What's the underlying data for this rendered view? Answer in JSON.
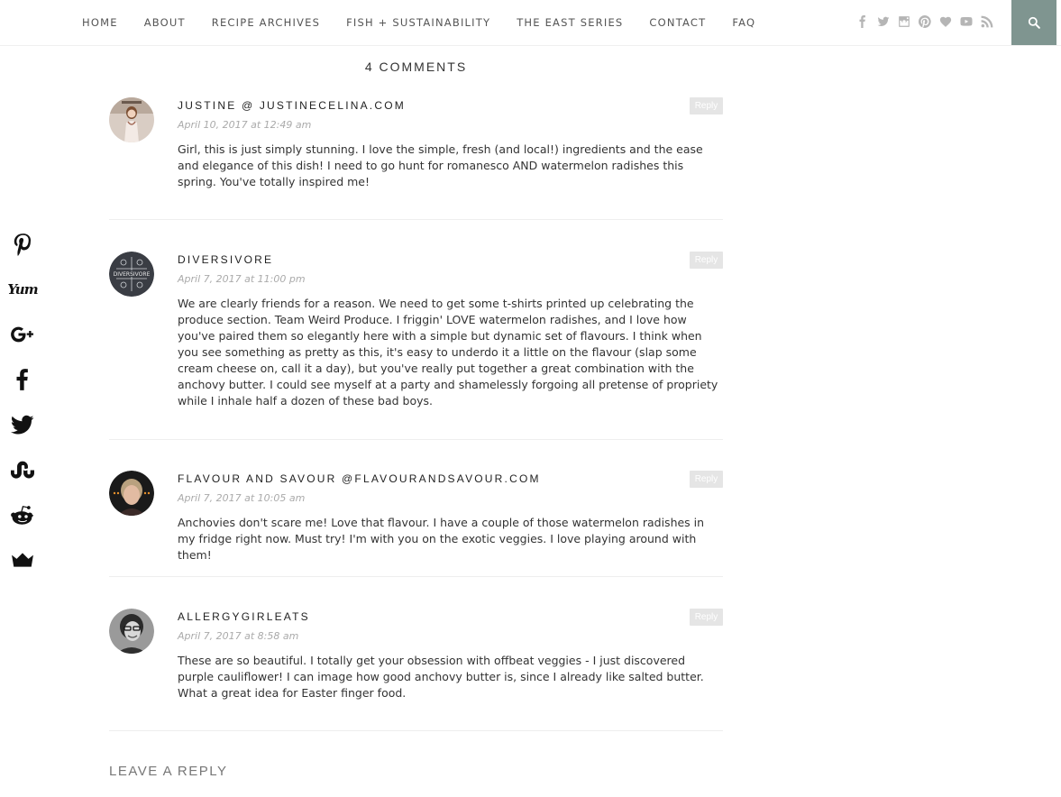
{
  "nav": {
    "items": [
      "HOME",
      "ABOUT",
      "RECIPE ARCHIVES",
      "FISH + SUSTAINABILITY",
      "THE EAST SERIES",
      "CONTACT",
      "FAQ"
    ]
  },
  "social_top": [
    "facebook-icon",
    "twitter-icon",
    "instagram-icon",
    "pinterest-icon",
    "bloglovin-heart-icon",
    "youtube-icon",
    "rss-icon"
  ],
  "share_bar": [
    "pinterest-icon",
    "yummly-icon",
    "google-plus-icon",
    "facebook-icon",
    "twitter-icon",
    "stumbleupon-icon",
    "reddit-icon",
    "sumo-crown-icon"
  ],
  "share_bar_yum": "Yum",
  "comments": {
    "title": "4 COMMENTS",
    "reply_label": "Reply",
    "items": [
      {
        "author": "JUSTINE @ JUSTINECELINA.COM",
        "date": "April 10, 2017 at 12:49 am",
        "text": "Girl, this is just simply stunning. I love the simple, fresh (and local!) ingredients and the ease and elegance of this dish! I need to go hunt for romanesco AND watermelon radishes this spring. You've totally inspired me!"
      },
      {
        "author": "DIVERSIVORE",
        "date": "April 7, 2017 at 11:00 pm",
        "text": "We are clearly friends for a reason. We need to get some t-shirts printed up celebrating the produce section. Team Weird Produce. I friggin' LOVE watermelon radishes, and I love how you've paired them so elegantly here with a simple but dynamic set of flavours. I think when you see something as pretty as this, it's easy to underdo it a little on the flavour (slap some cream cheese on, call it a day), but you've really put together a great combination with the anchovy butter. I could see myself at a party and shamelessly forgoing all pretense of propriety while I inhale half a dozen of these bad boys."
      },
      {
        "author": "FLAVOUR AND SAVOUR @FLAVOURANDSAVOUR.COM",
        "date": "April 7, 2017 at 10:05 am",
        "text": "Anchovies don't scare me! Love that flavour. I have a couple of those watermelon radishes in my fridge right now. Must try! I'm with you on the exotic veggies. I love playing around with them!"
      },
      {
        "author": "ALLERGYGIRLEATS",
        "date": "April 7, 2017 at 8:58 am",
        "text": "These are so beautiful. I totally get your obsession with offbeat veggies - I just discovered purple cauliflower! I can image how good anchovy butter is, since I already like salted butter. What a great idea for Easter finger food."
      }
    ],
    "diversivore_avatar_text": "DIVERSIVORE"
  },
  "leave_reply": "LEAVE A REPLY",
  "colors": {
    "search_bg": "#7f9590",
    "reply_bg": "#e5e5e5",
    "icon_grey": "#b5b5b5"
  }
}
